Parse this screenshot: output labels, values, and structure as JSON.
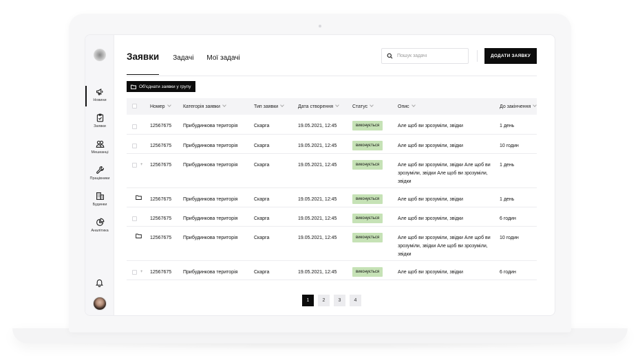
{
  "sidebar": {
    "items": [
      {
        "label": "Новини",
        "icon": "megaphone-icon",
        "active": true
      },
      {
        "label": "Заявки",
        "icon": "clipboard-icon",
        "active": false
      },
      {
        "label": "Мешканці",
        "icon": "users-icon",
        "active": false
      },
      {
        "label": "Працівники",
        "icon": "wrench-icon",
        "active": false
      },
      {
        "label": "Будинки",
        "icon": "buildings-icon",
        "active": false
      },
      {
        "label": "Аналітика",
        "icon": "pie-chart-icon",
        "active": false
      }
    ]
  },
  "header": {
    "tabs": [
      {
        "label": "Заявки"
      },
      {
        "label": "Задачі"
      },
      {
        "label": "Мої задачі"
      }
    ],
    "search_placeholder": "Пошук задачі",
    "add_button": "ДОДАТИ ЗАЯВКУ"
  },
  "group_button": "Об'єднати заявки у групу",
  "table": {
    "columns": [
      "Номер",
      "Категорія заявки",
      "Тип заявки",
      "Дата створення",
      "Статус",
      "Опис",
      "До закінчення"
    ],
    "rows": [
      {
        "marker": "none",
        "number": "12567675",
        "category": "Прибудинкова територія",
        "type": "Скарга",
        "date": "19.05.2021, 12:45",
        "status": "виконується",
        "description": "Але щоб ви зрозуміли, звідки",
        "remaining": "1 день"
      },
      {
        "marker": "none",
        "number": "12567675",
        "category": "Прибудинкова територія",
        "type": "Скарга",
        "date": "19.05.2021, 12:45",
        "status": "виконується",
        "description": "Але щоб ви зрозуміли, звідки",
        "remaining": "10 годин"
      },
      {
        "marker": "plus",
        "number": "12567675",
        "category": "Прибудинкова територія",
        "type": "Скарга",
        "date": "19.05.2021, 12:45",
        "status": "виконується",
        "description": "Але щоб ви зрозуміли, звідки Але щоб ви зрозуміли, звідки Але щоб ви зрозуміли, звідки",
        "remaining": "1 день"
      },
      {
        "marker": "folder",
        "number": "12567675",
        "category": "Прибудинкова територія",
        "type": "Скарга",
        "date": "19.05.2021, 12:45",
        "status": "виконується",
        "description": "Але щоб ви зрозуміли, звідки",
        "remaining": "1 день"
      },
      {
        "marker": "none",
        "number": "12567675",
        "category": "Прибудинкова територія",
        "type": "Скарга",
        "date": "19.05.2021, 12:45",
        "status": "виконується",
        "description": "Але щоб ви зрозуміли, звідки",
        "remaining": "6 годин"
      },
      {
        "marker": "folder",
        "number": "12567675",
        "category": "Прибудинкова територія",
        "type": "Скарга",
        "date": "19.05.2021, 12:45",
        "status": "виконується",
        "description": "Але щоб ви зрозуміли, звідки Але щоб ви зрозуміли, звідки Але щоб ви зрозуміли, звідки",
        "remaining": "10 годин"
      },
      {
        "marker": "plus",
        "number": "12567675",
        "category": "Прибудинкова територія",
        "type": "Скарга",
        "date": "19.05.2021, 12:45",
        "status": "виконується",
        "description": "Але щоб ви зрозуміли, звідки",
        "remaining": "6 годин"
      }
    ]
  },
  "pagination": {
    "pages": [
      "1",
      "2",
      "3",
      "4"
    ],
    "current": "1"
  },
  "colors": {
    "status_badge": "#c6e2b6",
    "primary": "#0c0c0c"
  }
}
